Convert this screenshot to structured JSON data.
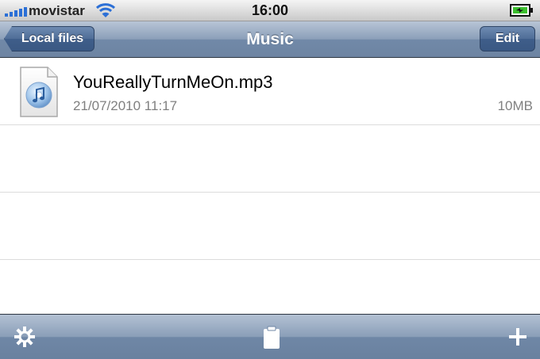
{
  "status_bar": {
    "carrier": "movistar",
    "time": "16:00",
    "icons": [
      "signal-bars-icon",
      "wifi-icon",
      "battery-charging-icon"
    ]
  },
  "nav_bar": {
    "back_label": "Local files",
    "title": "Music",
    "edit_label": "Edit"
  },
  "files": [
    {
      "name": "YouReallyTurnMeOn.mp3",
      "date": "21/07/2010 11:17",
      "size": "10MB",
      "icon": "music-file-icon"
    }
  ],
  "toolbar": {
    "icons": [
      "gear-icon",
      "clipboard-icon",
      "plus-icon"
    ]
  },
  "colors": {
    "nav_bar": "#8b9fb9",
    "button": "#4f6d97",
    "separator": "#dcdcdc",
    "secondary_text": "#808080",
    "battery_charge": "#3bbf2e"
  }
}
